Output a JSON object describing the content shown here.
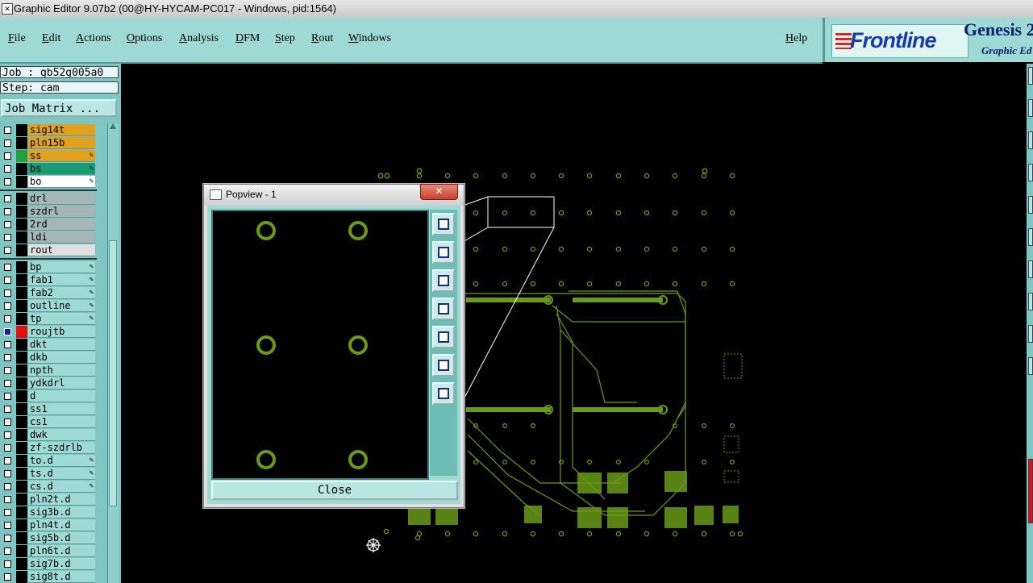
{
  "window": {
    "title": "Graphic Editor 9.07b2 (00@HY-HYCAM-PC017 - Windows, pid:1564)"
  },
  "menu": [
    "File",
    "Edit",
    "Actions",
    "Options",
    "Analysis",
    "DFM",
    "Step",
    "Rout",
    "Windows"
  ],
  "help_label": "Help",
  "brand": {
    "logo_text": "Frontline",
    "product": "Genesis 2",
    "subtitle": "Graphic Ed"
  },
  "job": {
    "job_label": "Job : gb52g005a0",
    "step_label": "Step: cam",
    "matrix_button": "Job Matrix ..."
  },
  "layers": [
    {
      "name": "sig14t",
      "color": "#e0a020",
      "edit": false,
      "active": false
    },
    {
      "name": "pln15b",
      "color": "#e0a020",
      "edit": false,
      "active": false
    },
    {
      "name": "ss",
      "color": "#e0a020",
      "edit": true,
      "active": false,
      "swatch": "#1fa040"
    },
    {
      "name": "bs",
      "color": "#1a9a72",
      "edit": true,
      "active": false
    },
    {
      "name": "bo",
      "color": "#ffffff",
      "edit": true,
      "active": false
    },
    {
      "name": "drl",
      "color": "#a6b6b8",
      "edit": false,
      "active": false
    },
    {
      "name": "szdrl",
      "color": "#a6b6b8",
      "edit": false,
      "active": false
    },
    {
      "name": "2rd",
      "color": "#a6b6b8",
      "edit": false,
      "active": false
    },
    {
      "name": "ldi",
      "color": "#a6b6b8",
      "edit": false,
      "active": false
    },
    {
      "name": "rout",
      "color": "#e0e0e0",
      "edit": false,
      "active": false
    },
    {
      "name": "bp",
      "color": "#9ed9d5",
      "edit": true,
      "active": false
    },
    {
      "name": "fab1",
      "color": "#9ed9d5",
      "edit": true,
      "active": false
    },
    {
      "name": "fab2",
      "color": "#9ed9d5",
      "edit": true,
      "active": false
    },
    {
      "name": "outline",
      "color": "#9ed9d5",
      "edit": true,
      "active": false
    },
    {
      "name": "tp",
      "color": "#9ed9d5",
      "edit": true,
      "active": false
    },
    {
      "name": "roujtb",
      "color": "#9ed9d5",
      "edit": false,
      "active": true,
      "swatch": "#e01010"
    },
    {
      "name": "dkt",
      "color": "#9ed9d5",
      "edit": false,
      "active": false
    },
    {
      "name": "dkb",
      "color": "#9ed9d5",
      "edit": false,
      "active": false
    },
    {
      "name": "npth",
      "color": "#9ed9d5",
      "edit": false,
      "active": false
    },
    {
      "name": "ydkdrl",
      "color": "#9ed9d5",
      "edit": false,
      "active": false
    },
    {
      "name": "d",
      "color": "#9ed9d5",
      "edit": false,
      "active": false
    },
    {
      "name": "ss1",
      "color": "#9ed9d5",
      "edit": false,
      "active": false
    },
    {
      "name": "cs1",
      "color": "#9ed9d5",
      "edit": false,
      "active": false
    },
    {
      "name": "dwk",
      "color": "#9ed9d5",
      "edit": false,
      "active": false
    },
    {
      "name": "zf-szdrlb",
      "color": "#9ed9d5",
      "edit": false,
      "active": false
    },
    {
      "name": "to.d",
      "color": "#9ed9d5",
      "edit": true,
      "active": false
    },
    {
      "name": "ts.d",
      "color": "#9ed9d5",
      "edit": true,
      "active": false
    },
    {
      "name": "cs.d",
      "color": "#9ed9d5",
      "edit": true,
      "active": false
    },
    {
      "name": "pln2t.d",
      "color": "#9ed9d5",
      "edit": false,
      "active": false
    },
    {
      "name": "sig3b.d",
      "color": "#9ed9d5",
      "edit": false,
      "active": false
    },
    {
      "name": "pln4t.d",
      "color": "#9ed9d5",
      "edit": false,
      "active": false
    },
    {
      "name": "sig5b.d",
      "color": "#9ed9d5",
      "edit": false,
      "active": false
    },
    {
      "name": "pln6t.d",
      "color": "#9ed9d5",
      "edit": false,
      "active": false
    },
    {
      "name": "sig7b.d",
      "color": "#9ed9d5",
      "edit": false,
      "active": false
    },
    {
      "name": "sig8t.d",
      "color": "#9ed9d5",
      "edit": false,
      "active": false
    }
  ],
  "popview": {
    "title": "Popview - 1",
    "close_label": "Close"
  },
  "colors": {
    "pcb_green": "#6a9a1a",
    "panel": "#9ed9d5",
    "menu_bg": "#9ed9d5"
  }
}
